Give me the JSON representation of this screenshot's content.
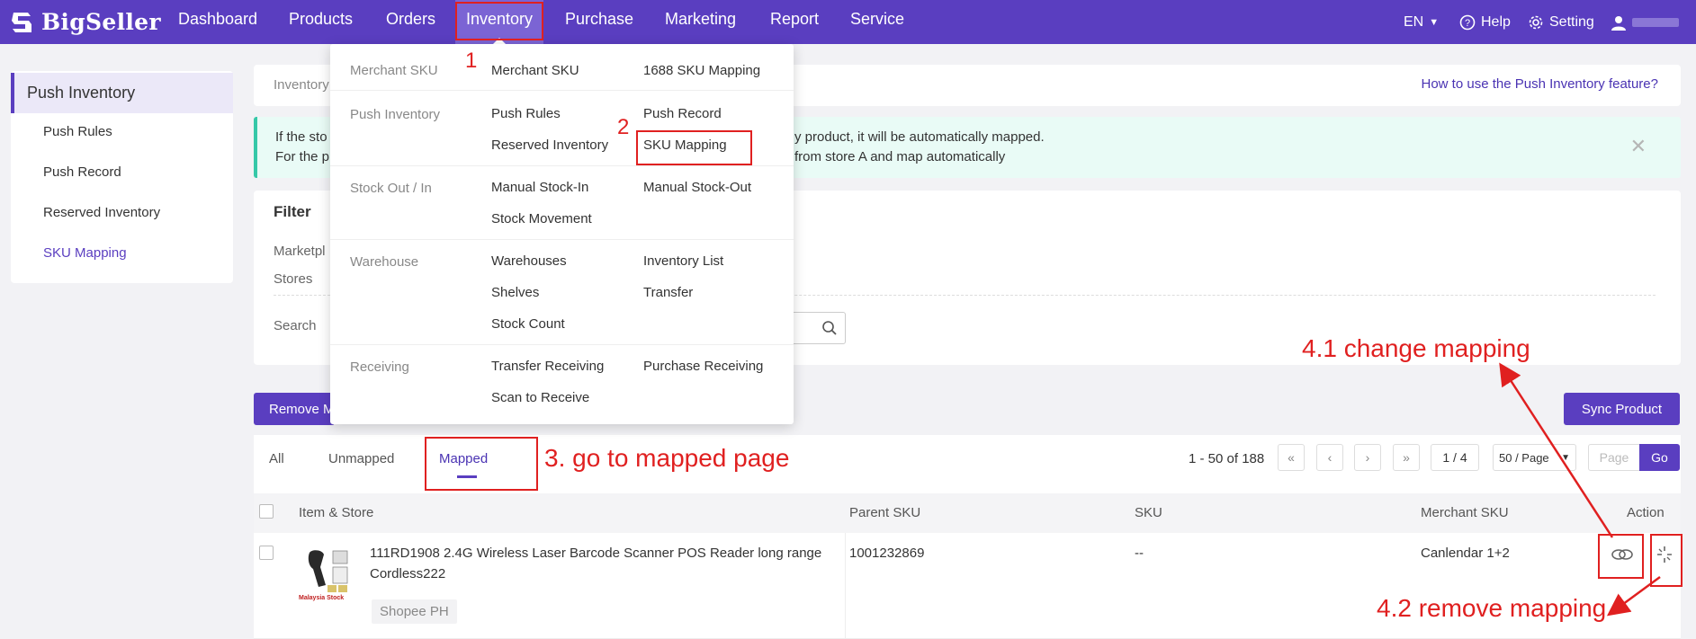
{
  "brand": {
    "name": "BigSeller"
  },
  "nav": {
    "items": [
      "Dashboard",
      "Products",
      "Orders",
      "Inventory",
      "Purchase",
      "Marketing",
      "Report",
      "Service"
    ],
    "language": "EN",
    "help": "Help",
    "setting": "Setting"
  },
  "sidebar": {
    "header": "Push Inventory",
    "items": [
      "Push Rules",
      "Push Record",
      "Reserved Inventory",
      "SKU Mapping"
    ]
  },
  "breadcrumb": {
    "text": "Inventory",
    "help_link": "How to use the Push Inventory feature?"
  },
  "alert": {
    "line1_left": "If the sto",
    "line1_right": "y product, it will be automatically mapped.",
    "line2_left": "For the p",
    "line2_right": "from store A and map automatically"
  },
  "filter": {
    "title": "Filter",
    "marketplace_label": "Marketpl",
    "stores_label": "Stores",
    "search_label": "Search"
  },
  "dropdown": {
    "groups": [
      {
        "label": "Merchant SKU",
        "items": [
          "Merchant SKU",
          "1688 SKU Mapping"
        ]
      },
      {
        "label": "Push Inventory",
        "items": [
          "Push Rules",
          "Push Record",
          "Reserved Inventory",
          "SKU Mapping"
        ]
      },
      {
        "label": "Stock Out / In",
        "items": [
          "Manual Stock-In",
          "Manual Stock-Out",
          "Stock Movement"
        ]
      },
      {
        "label": "Warehouse",
        "items": [
          "Warehouses",
          "Inventory List",
          "Shelves",
          "Transfer",
          "Stock Count"
        ]
      },
      {
        "label": "Receiving",
        "items": [
          "Transfer Receiving",
          "Purchase Receiving",
          "Scan to Receive"
        ]
      }
    ]
  },
  "actions": {
    "remove_label": "Remove M",
    "sync_label": "Sync Product"
  },
  "tabs": [
    "All",
    "Unmapped",
    "Mapped"
  ],
  "pagination": {
    "summary": "1 - 50 of 188",
    "page": "1 / 4",
    "page_size": "50 / Page",
    "page_placeholder": "Page",
    "go_label": "Go"
  },
  "table": {
    "columns": [
      "Item & Store",
      "Parent SKU",
      "SKU",
      "Merchant SKU",
      "Action"
    ],
    "rows": [
      {
        "title_line1": "111RD1908 2.4G Wireless Laser Barcode Scanner POS Reader long range",
        "title_line2": "Cordless222",
        "store": "Shopee PH",
        "thumb_caption": "Malaysia Stock",
        "parent_sku": "1001232869",
        "sku": "--",
        "merchant_sku": "Canlendar 1+2"
      }
    ]
  },
  "annotations": {
    "step1": "1",
    "step2": "2",
    "step3": "3. go to mapped page",
    "step41": "4.1 change mapping",
    "step42": "4.2 remove mapping"
  },
  "colors": {
    "brand": "#5a3ec0",
    "annotation": "#e02020",
    "alert_bg": "#e9fbf6"
  }
}
